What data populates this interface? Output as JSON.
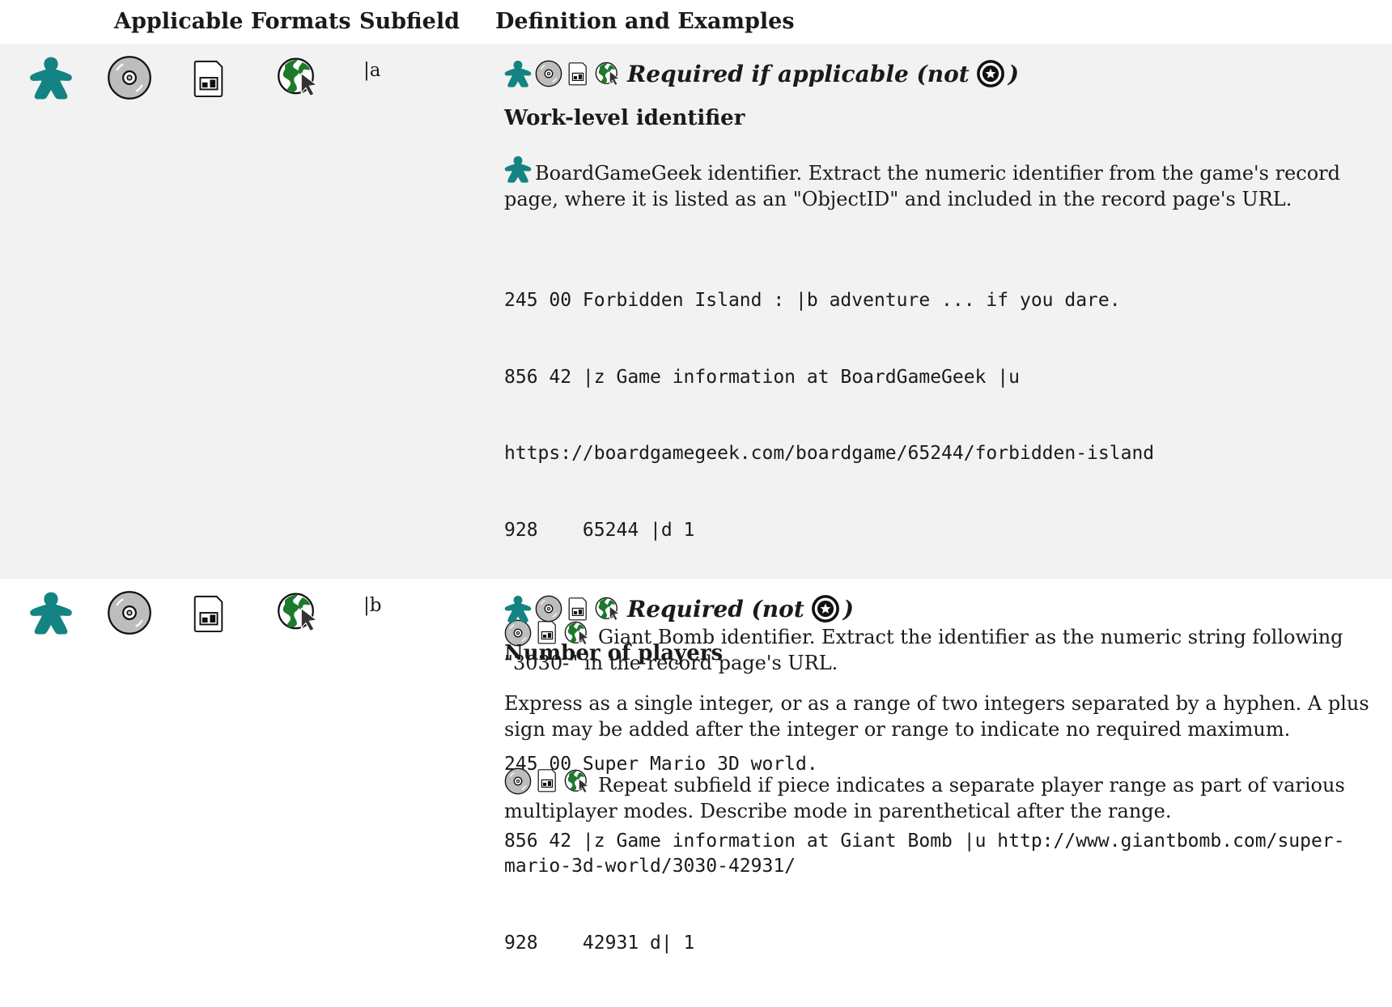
{
  "header": {
    "formats": "Applicable Formats",
    "subfield": "Subfield",
    "definition": "Definition and Examples"
  },
  "rows": [
    {
      "subfield": "|a",
      "requirement": "Required if applicable (not",
      "requirement_close": ")",
      "title": "Work-level identifier",
      "para1": "BoardGameGeek identifier. Extract the numeric identifier from the game's record page, where it is listed as an \"ObjectID\" and included in the record page's URL.",
      "code1": [
        "245 00 Forbidden Island : |b adventure ... if you dare.",
        "856 42 |z Game information at BoardGameGeek |u",
        "https://boardgamegeek.com/boardgame/65244/forbidden-island",
        "928    65244 |d 1"
      ],
      "para2": "Giant Bomb identifier. Extract the identifier as the numeric string following \"3030-\" in the record page's URL.",
      "code2": [
        "245 00 Super Mario 3D world.",
        "856 42 |z Game information at Giant Bomb |u http://www.giantbomb.com/super-mario-3d-world/3030-42931/",
        "928    42931 d| 1"
      ]
    },
    {
      "subfield": "|b",
      "requirement": "Required (not",
      "requirement_close": ")",
      "title": "Number of players",
      "para1": "Express as a single integer, or as a range of two integers separated by a hyphen. A plus sign may be added after the integer or range to indicate no required maximum.",
      "para2": "Repeat subfield if piece indicates a separate player range as part of various multiplayer modes. Describe mode in parenthetical after the range."
    }
  ],
  "icons": {
    "formats": [
      "meeple-icon",
      "disc-icon",
      "cartridge-icon",
      "globe-cursor-icon"
    ],
    "colors": {
      "meeple": "#138383",
      "globe": "#1d7a2a",
      "disc": "#bdbdbd"
    }
  }
}
